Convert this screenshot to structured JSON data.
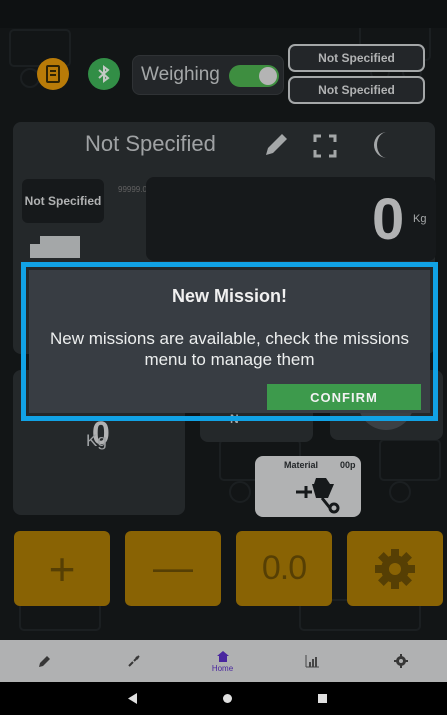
{
  "header": {
    "mode_label": "Weighing",
    "mode_enabled": true,
    "field_top": "Not Specified",
    "field_bottom": "Not Specified",
    "icons": [
      "printer-icon",
      "bluetooth-icon"
    ]
  },
  "panel": {
    "title": "Not Specified",
    "icons": [
      "pencil-icon",
      "fullscreen-icon",
      "moon-icon"
    ],
    "vehicle_label": "Not Specified",
    "tiny_value": "99999.0",
    "weight_value": "0",
    "weight_unit": "Kg"
  },
  "lower": {
    "small_value": "0",
    "small_unit": "Kg",
    "material_label": "Material",
    "material_count": "00p",
    "icons": [
      "wheelbarrow-icon"
    ]
  },
  "actions": {
    "plus": "+",
    "minus": "—",
    "tare": "0.0",
    "icons": [
      "gear-icon"
    ]
  },
  "nav": {
    "home_label": "Home",
    "items": [
      "pencil-icon",
      "brush-icon",
      "home-icon",
      "chart-icon",
      "gear-icon"
    ],
    "active_color": "#5a2fc2"
  },
  "dialog": {
    "title": "New Mission!",
    "message": "New missions are available, check the missions menu to manage them",
    "confirm_label": "CONFIRM",
    "accent": "#3d9a4c",
    "highlight": "#11a2e5"
  },
  "colors": {
    "background": "#161a1c",
    "action_button": "#a87905",
    "toggle_on": "#4cae4f"
  }
}
